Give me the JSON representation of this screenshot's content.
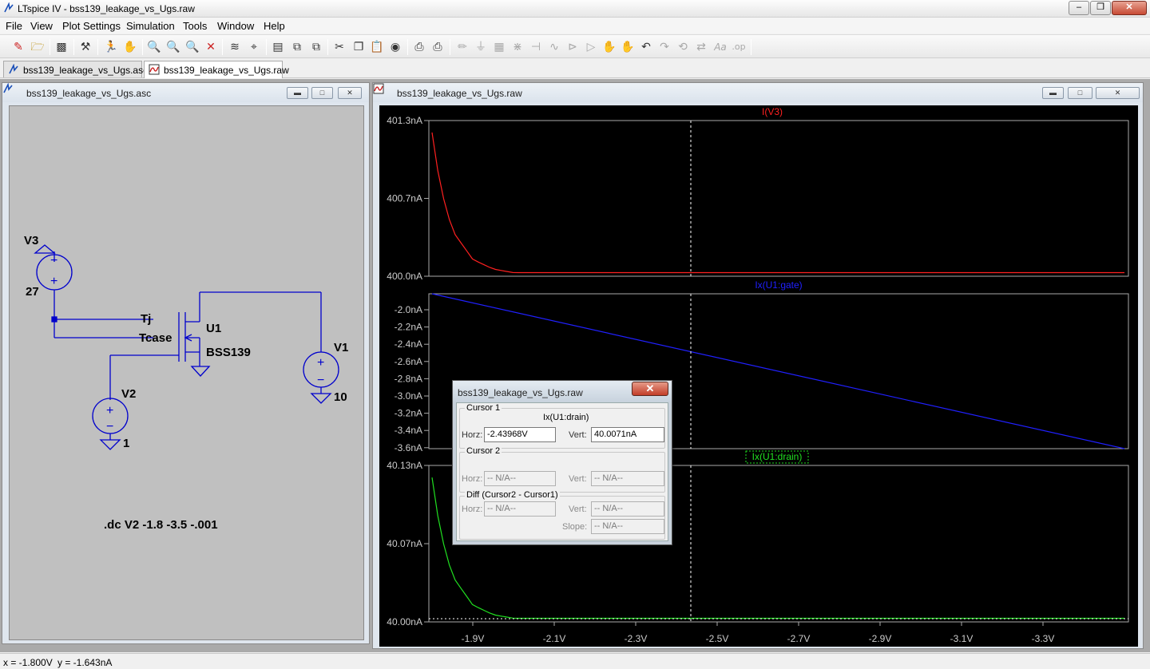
{
  "window": {
    "title": "LTspice IV - bss139_leakage_vs_Ugs.raw",
    "minimize": "–",
    "restore": "❒",
    "close": "✕"
  },
  "menu": [
    "File",
    "View",
    "Plot Settings",
    "Simulation",
    "Tools",
    "Window",
    "Help"
  ],
  "toolbar_icons": [
    "new-schematic",
    "open",
    "save",
    "control-panel",
    "run",
    "halt",
    "zoom-in",
    "pan",
    "zoom-out",
    "zoom-cancel",
    "autorange",
    "mark-unused",
    "tile-horizontal",
    "tile-vertical",
    "cascade",
    "cut",
    "copy",
    "paste",
    "find",
    "print-setup",
    "print",
    "wire",
    "ground",
    "label",
    "resistor",
    "capacitor",
    "inductor",
    "diode",
    "component",
    "move",
    "drag",
    "undo",
    "redo",
    "rotate",
    "mirror",
    "text",
    "spice-directive"
  ],
  "tabs": [
    {
      "label": "bss139_leakage_vs_Ugs.asc",
      "active": false
    },
    {
      "label": "bss139_leakage_vs_Ugs.raw",
      "active": true
    }
  ],
  "schematic": {
    "title": "bss139_leakage_vs_Ugs.asc",
    "components": {
      "v3_name": "V3",
      "v3_value": "27",
      "v1_name": "V1",
      "v1_value": "10",
      "v2_name": "V2",
      "v2_value": "1",
      "u1_name": "U1",
      "u1_model": "BSS139",
      "pin_tj": "Tj",
      "pin_tcase": "Tcase"
    },
    "directive": ".dc V2 -1.8 -3.5 -.001"
  },
  "waveform": {
    "title": "bss139_leakage_vs_Ugs.raw",
    "panes": [
      {
        "trace": "I(V3)",
        "color": "#ff2020",
        "yticks": [
          "401.3nA",
          "400.7nA",
          "400.0nA"
        ]
      },
      {
        "trace": "Ix(U1:gate)",
        "color": "#2020ff",
        "yticks": [
          "-2.0nA",
          "-2.2nA",
          "-2.4nA",
          "-2.6nA",
          "-2.8nA",
          "-3.0nA",
          "-3.2nA",
          "-3.4nA",
          "-3.6nA"
        ]
      },
      {
        "trace": "Ix(U1:drain)",
        "color": "#20e020",
        "yticks": [
          "40.13nA",
          "40.07nA",
          "40.00nA"
        ]
      }
    ],
    "xticks": [
      "-1.9V",
      "-2.1V",
      "-2.3V",
      "-2.5V",
      "-2.7V",
      "-2.9V",
      "-3.1V",
      "-3.3V"
    ]
  },
  "chart_data": [
    {
      "type": "line",
      "title": "I(V3)",
      "xlabel": "",
      "ylabel": "",
      "xlim": [
        -1.8,
        -3.5
      ],
      "ylim": [
        400.0,
        401.3
      ],
      "series": [
        {
          "name": "I(V3)",
          "x": [
            -1.8,
            -1.82,
            -1.85,
            -1.9,
            -1.95,
            -2.0,
            -2.5,
            -3.0,
            -3.5
          ],
          "y": [
            401.2,
            400.75,
            400.38,
            400.14,
            400.06,
            400.03,
            400.03,
            400.03,
            400.03
          ]
        }
      ]
    },
    {
      "type": "line",
      "title": "Ix(U1:gate)",
      "xlabel": "",
      "ylabel": "",
      "xlim": [
        -1.8,
        -3.5
      ],
      "ylim": [
        -3.6,
        -1.9
      ],
      "series": [
        {
          "name": "Ix(U1:gate)",
          "x": [
            -1.8,
            -3.5
          ],
          "y": [
            -1.9,
            -3.6
          ]
        }
      ]
    },
    {
      "type": "line",
      "title": "Ix(U1:drain)",
      "xlabel": "",
      "ylabel": "",
      "xlim": [
        -1.8,
        -3.5
      ],
      "ylim": [
        40.0,
        40.13
      ],
      "series": [
        {
          "name": "Ix(U1:drain)",
          "x": [
            -1.8,
            -1.82,
            -1.85,
            -1.9,
            -1.95,
            -2.0,
            -2.5,
            -3.0,
            -3.5
          ],
          "y": [
            40.12,
            40.075,
            40.038,
            40.014,
            40.006,
            40.003,
            40.003,
            40.003,
            40.003
          ]
        }
      ]
    }
  ],
  "cursor_dialog": {
    "title": "bss139_leakage_vs_Ugs.raw",
    "close": "✕",
    "cursor1_label": "Cursor 1",
    "cursor1_trace": "Ix(U1:drain)",
    "horz_label": "Horz:",
    "vert_label": "Vert:",
    "cursor1_horz": "-2.43968V",
    "cursor1_vert": "40.0071nA",
    "cursor2_label": "Cursor 2",
    "cursor2_horz": "-- N/A--",
    "cursor2_vert": "-- N/A--",
    "diff_label": "Diff (Cursor2 - Cursor1)",
    "diff_horz": "-- N/A--",
    "diff_vert": "-- N/A--",
    "slope_label": "Slope:",
    "diff_slope": "-- N/A--"
  },
  "status": {
    "x": "x = -1.800V",
    "y": "y = -1.643nA"
  }
}
